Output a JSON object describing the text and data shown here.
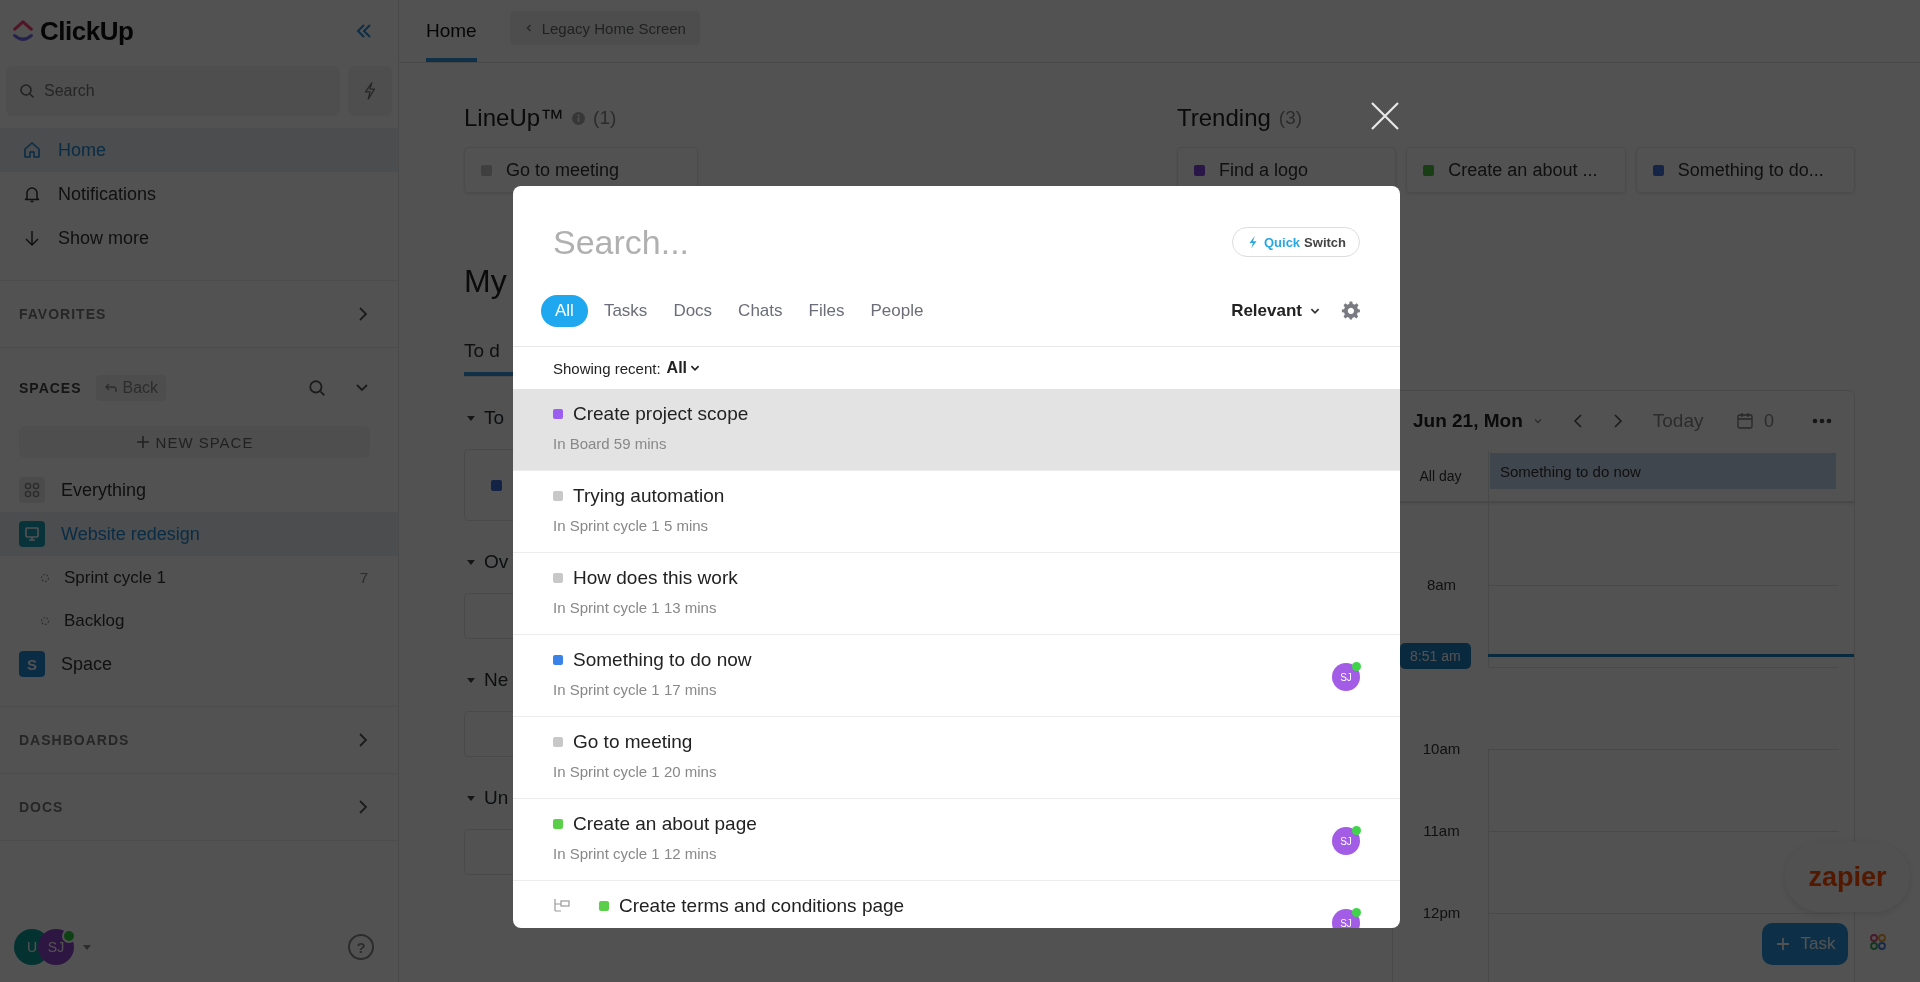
{
  "sidebar": {
    "logo": "ClickUp",
    "search": {
      "placeholder": "Search"
    },
    "nav": [
      {
        "label": "Home",
        "kind": "home",
        "selected": true
      },
      {
        "label": "Notifications",
        "kind": "bell",
        "selected": false
      },
      {
        "label": "Show more",
        "kind": "arrow",
        "selected": false
      }
    ],
    "favorites": "FAVORITES",
    "spaces": {
      "title": "SPACES",
      "back": "Back",
      "new_space": "NEW SPACE",
      "items": [
        {
          "label": "Everything",
          "kind": "everything",
          "selected": false
        },
        {
          "label": "Website redesign",
          "kind": "monitor",
          "selected": true,
          "children": [
            {
              "label": "Sprint cycle 1",
              "count": "7"
            },
            {
              "label": "Backlog"
            }
          ]
        },
        {
          "label": "Space",
          "kind": "letter",
          "badge": "S",
          "selected": false
        }
      ]
    },
    "dashboards": "DASHBOARDS",
    "docs": "DOCS",
    "user": {
      "avatars": [
        "U",
        "SJ"
      ],
      "help": "?"
    }
  },
  "header": {
    "tabs": [
      {
        "label": "Home",
        "selected": true
      }
    ],
    "legacy_button": "Legacy Home Screen"
  },
  "lineup": {
    "title": "LineUp™",
    "count": "(1)",
    "cards": [
      {
        "label": "Go to meeting",
        "color": "#3f3f3f"
      }
    ]
  },
  "trending": {
    "title": "Trending",
    "count": "(3)",
    "cards": [
      {
        "label": "Find a logo",
        "color": "#2a1548"
      },
      {
        "label": "Create an about ...",
        "color": "#193d14"
      },
      {
        "label": "Something to do...",
        "color": "#152548"
      }
    ]
  },
  "my_work": {
    "title": "My",
    "tabs": [
      {
        "label": "To d",
        "selected": true
      }
    ],
    "sections": [
      "To",
      "Ov",
      "Ne",
      "Un"
    ]
  },
  "calendar": {
    "date": "Jun 21, Mon",
    "today": "Today",
    "count": "0",
    "all_day_label": "All day",
    "all_day_event": "Something to do now",
    "hours": [
      "8am",
      "10am",
      "11am",
      "12pm"
    ],
    "now": "8:51 am"
  },
  "floating": {
    "zapier": "zapier",
    "task_button": "Task"
  },
  "modal": {
    "search": {
      "placeholder": "Search..."
    },
    "quickswitch": {
      "accent": "Quick",
      "rest": "Switch"
    },
    "filters": [
      {
        "label": "All",
        "selected": true
      },
      {
        "label": "Tasks",
        "selected": false
      },
      {
        "label": "Docs",
        "selected": false
      },
      {
        "label": "Chats",
        "selected": false
      },
      {
        "label": "Files",
        "selected": false
      },
      {
        "label": "People",
        "selected": false
      }
    ],
    "sort": "Relevant",
    "recent": {
      "label": "Showing recent:",
      "value": "All"
    },
    "results": [
      {
        "title": "Create project scope",
        "location": "In Board 59 mins",
        "color": "#9b5cf0",
        "selected": true
      },
      {
        "title": "Trying automation",
        "location": "In Sprint cycle 1 5 mins",
        "color": "#c8c8c8",
        "selected": false
      },
      {
        "title": "How does this work",
        "location": "In Sprint cycle 1 13 mins",
        "color": "#c8c8c8",
        "selected": false
      },
      {
        "title": "Something to do now",
        "location": "In Sprint cycle 1 17 mins",
        "color": "#3b82e8",
        "selected": false,
        "assignee": "SJ"
      },
      {
        "title": "Go to meeting",
        "location": "In Sprint cycle 1 20 mins",
        "color": "#c8c8c8",
        "selected": false
      },
      {
        "title": "Create an about page",
        "location": "In Sprint cycle 1 12 mins",
        "color": "#5ccf4a",
        "selected": false,
        "assignee": "SJ"
      },
      {
        "title": "Create terms and conditions page",
        "kind": "subtask",
        "color": "#5ccf4a",
        "selected": false,
        "assignee": "SJ"
      }
    ]
  }
}
